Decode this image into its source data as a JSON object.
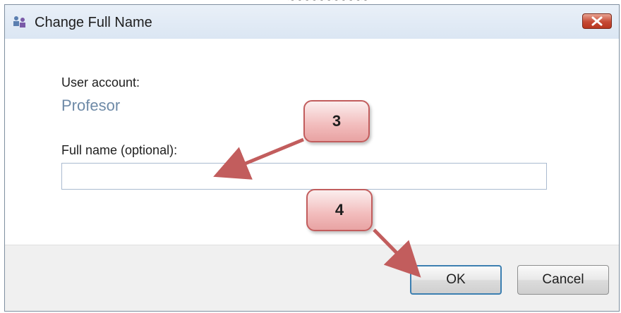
{
  "window": {
    "title": "Change Full Name",
    "icon": "users-app-icon",
    "close_icon": "close-icon"
  },
  "content": {
    "user_account_label": "User account:",
    "user_account_value": "Profesor",
    "full_name_label": "Full name (optional):",
    "full_name_value": "",
    "full_name_placeholder": ""
  },
  "buttons": {
    "ok_label": "OK",
    "cancel_label": "Cancel"
  },
  "annotations": {
    "step3": "3",
    "step4": "4",
    "color": "#c25d5d"
  },
  "colors": {
    "titlebar": "#dbe6f3",
    "close_button": "#c64a35",
    "account_text": "#6e8aa7",
    "ok_border": "#3c7fb1"
  }
}
